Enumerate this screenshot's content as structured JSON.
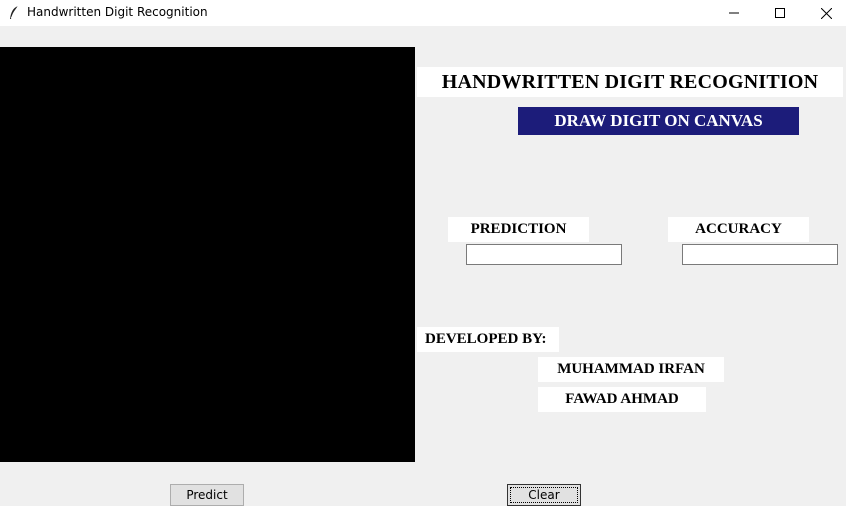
{
  "window": {
    "title": "Handwritten Digit Recognition",
    "icon": "feather-icon",
    "controls": [
      "minimize-icon",
      "maximize-icon",
      "close-icon"
    ]
  },
  "main": {
    "heading": "HANDWRITTEN DIGIT RECOGNITION",
    "subheading": "DRAW DIGIT ON CANVAS",
    "subheading_bg": "#1c1c7a",
    "canvas_color": "#000000"
  },
  "results": {
    "prediction_label": "PREDICTION",
    "prediction_value": "",
    "accuracy_label": "ACCURACY",
    "accuracy_value": ""
  },
  "credits": {
    "developed_by_label": "DEVELOPED BY:",
    "names": [
      "MUHAMMAD IRFAN",
      "FAWAD AHMAD"
    ]
  },
  "buttons": {
    "predict_label": "Predict",
    "clear_label": "Clear"
  }
}
